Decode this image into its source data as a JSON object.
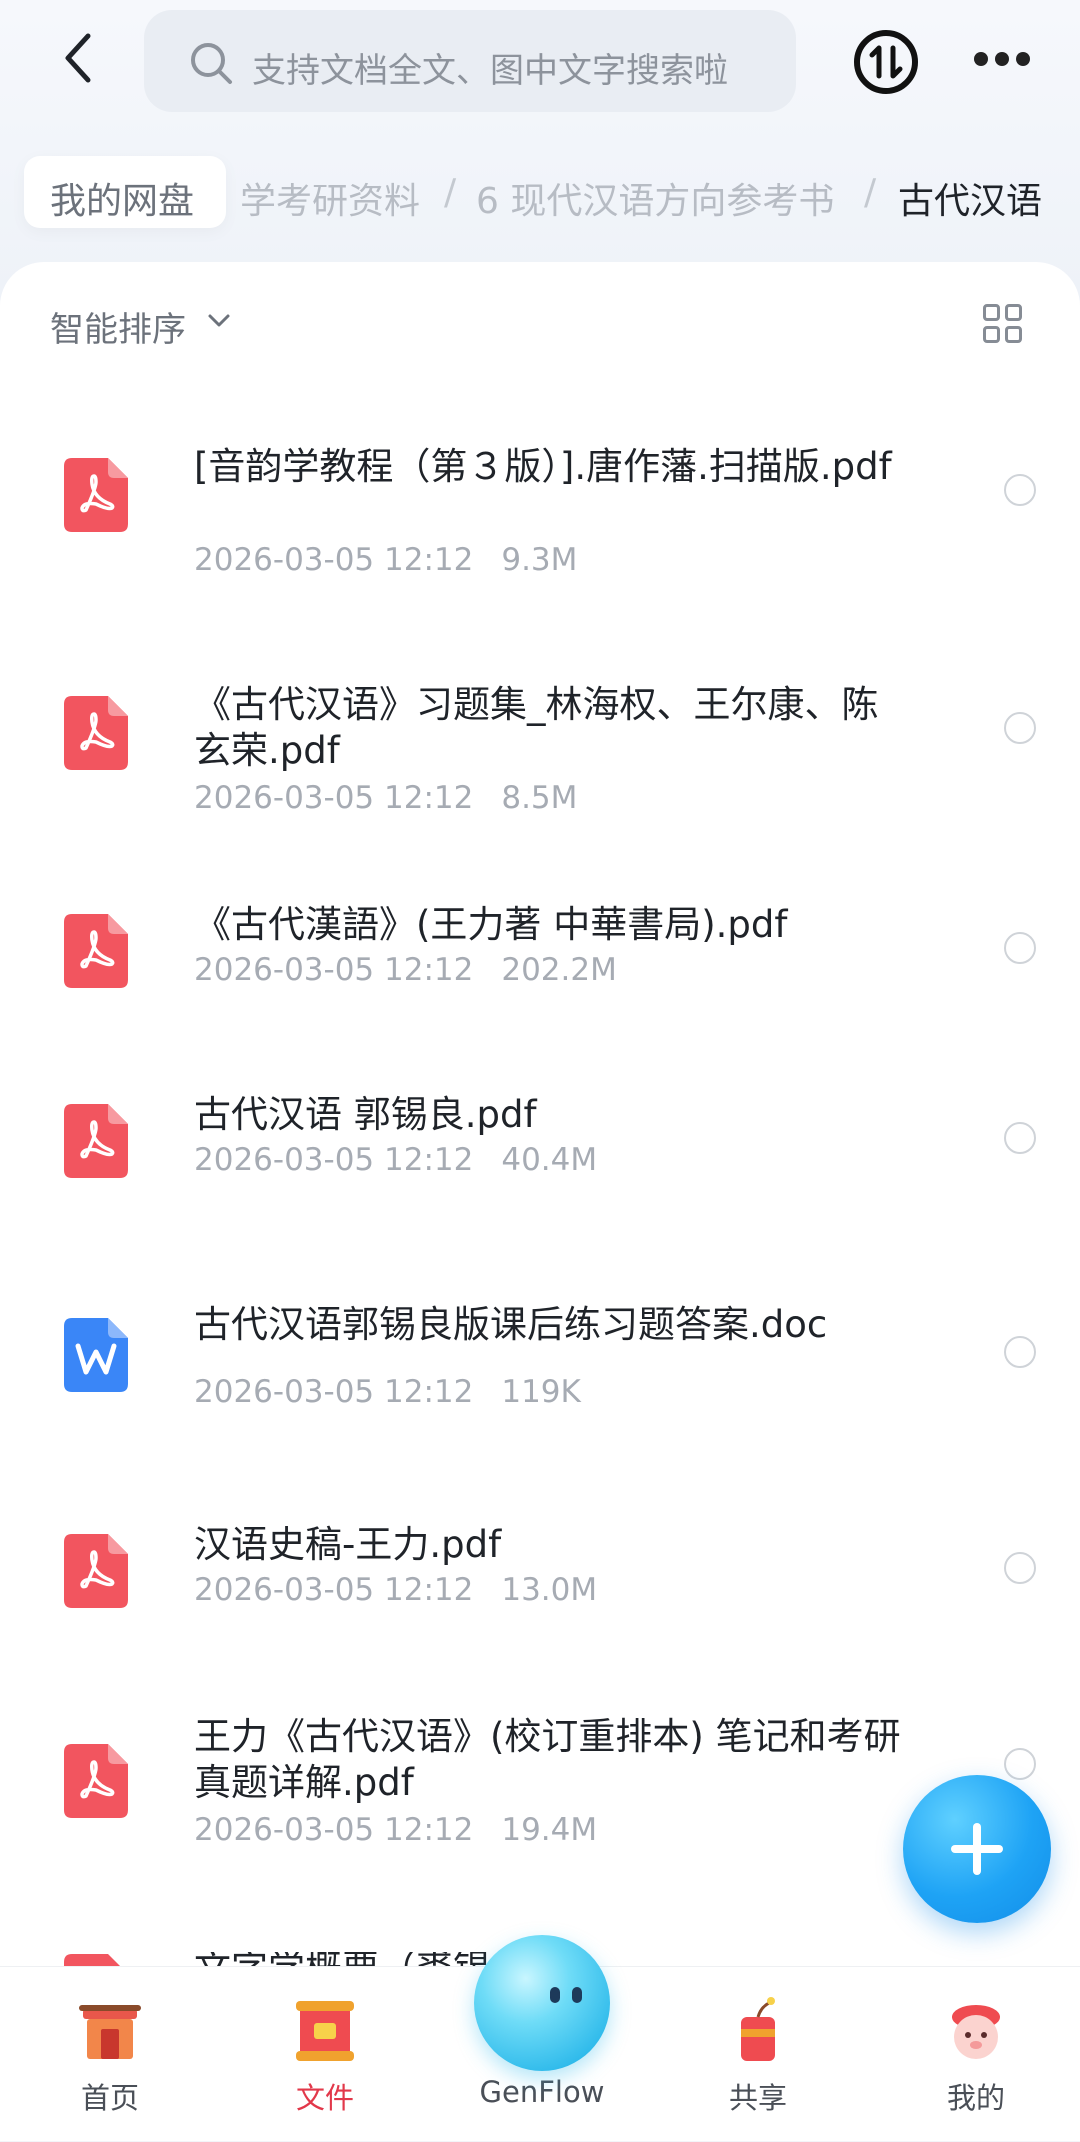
{
  "header": {
    "search_placeholder": "支持文档全文、图中文字搜索啦"
  },
  "breadcrumb": {
    "root": "我的网盘",
    "items": [
      "学考研资料",
      "6 现代汉语方向参考书",
      "古代汉语"
    ],
    "separator": "/"
  },
  "toolbar": {
    "sort_label": "智能排序"
  },
  "files": [
    {
      "name": "[音韵学教程（第３版）].唐作藩.扫描版.pdf",
      "date": "2026-03-05 12:12",
      "size": "9.3M",
      "type": "pdf"
    },
    {
      "name": "《古代汉语》习题集_林海权、王尔康、陈玄荣.pdf",
      "date": "2026-03-05 12:12",
      "size": "8.5M",
      "type": "pdf"
    },
    {
      "name": "《古代漢語》(王力著 中華書局).pdf",
      "date": "2026-03-05 12:12",
      "size": "202.2M",
      "type": "pdf"
    },
    {
      "name": "古代汉语 郭锡良.pdf",
      "date": "2026-03-05 12:12",
      "size": "40.4M",
      "type": "pdf"
    },
    {
      "name": "古代汉语郭锡良版课后练习题答案.doc",
      "date": "2026-03-05 12:12",
      "size": "119K",
      "type": "doc"
    },
    {
      "name": "汉语史稿-王力.pdf",
      "date": "2026-03-05 12:12",
      "size": "13.0M",
      "type": "pdf"
    },
    {
      "name": "王力《古代汉语》(校订重排本) 笔记和考研真题详解.pdf",
      "date": "2026-03-05 12:12",
      "size": "19.4M",
      "type": "pdf"
    },
    {
      "name": "文字学概要（裘锡圭）",
      "date": "",
      "size": "",
      "type": "pdf"
    }
  ],
  "tabs": [
    {
      "label": "首页",
      "icon": "home-gate-icon"
    },
    {
      "label": "文件",
      "icon": "files-scroll-icon",
      "active": true
    },
    {
      "label": "GenFlow",
      "icon": "genflow-orb-icon"
    },
    {
      "label": "共享",
      "icon": "share-firecracker-icon"
    },
    {
      "label": "我的",
      "icon": "profile-avatar-icon"
    }
  ],
  "colors": {
    "pdf_icon": "#f2555f",
    "doc_icon": "#3a86f7",
    "active_tab": "#e2384a",
    "fab": "#1ea3f5"
  }
}
